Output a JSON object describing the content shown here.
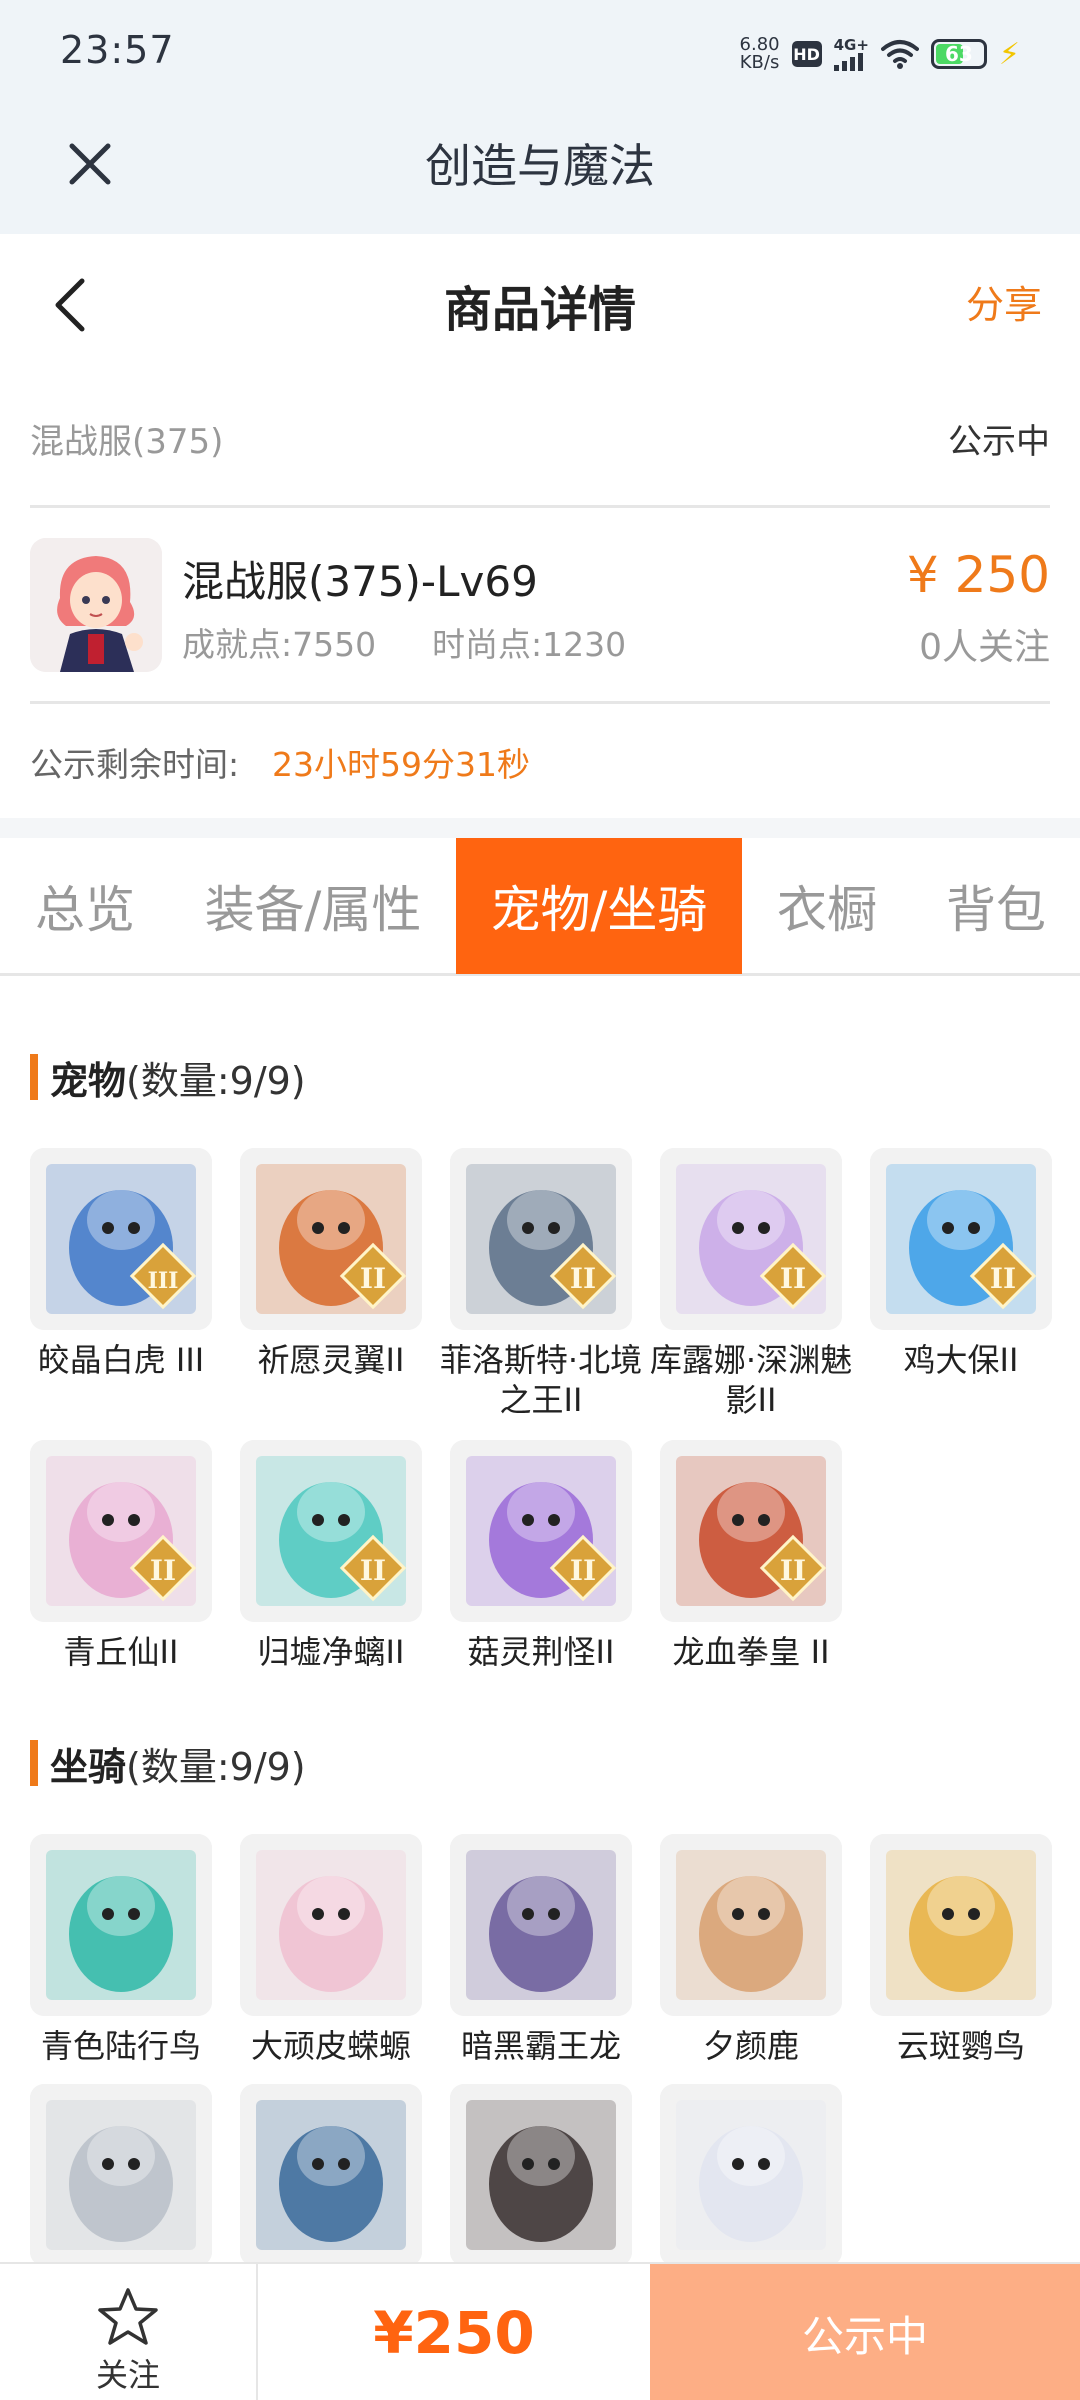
{
  "status_bar": {
    "time": "23:57",
    "net_speed_value": "6.80",
    "net_speed_unit": "KB/s",
    "hd": "HD",
    "signal": "4G+",
    "battery": "63"
  },
  "app": {
    "title": "创造与魔法"
  },
  "header": {
    "title": "商品详情",
    "share": "分享"
  },
  "item": {
    "server": "混战服(375)",
    "status": "公示中",
    "name": "混战服(375)-Lv69",
    "achievement": "成就点:7550",
    "fashion": "时尚点:1230",
    "price": "¥ 250",
    "followers": "0人关注",
    "timer_label": "公示剩余时间:",
    "timer_value": "23小时59分31秒"
  },
  "tabs": [
    "总览",
    "装备/属性",
    "宠物/坐骑",
    "衣橱",
    "背包"
  ],
  "pets": {
    "title": "宠物",
    "count": "(数量:9/9)",
    "items": [
      {
        "name": "皎晶白虎 III",
        "tier": "III",
        "color": "#3f78c8"
      },
      {
        "name": "祈愿灵翼II",
        "tier": "II",
        "color": "#d86a2a"
      },
      {
        "name": "菲洛斯特·北境之王II",
        "tier": "II",
        "color": "#5a7088"
      },
      {
        "name": "库露娜·深渊魅影II",
        "tier": "II",
        "color": "#c8a8e8"
      },
      {
        "name": "鸡大保II",
        "tier": "II",
        "color": "#3a9ee8"
      },
      {
        "name": "青丘仙II",
        "tier": "II",
        "color": "#e8a8d0"
      },
      {
        "name": "归墟净螭II",
        "tier": "II",
        "color": "#4cc8c0"
      },
      {
        "name": "菇灵荆怪II",
        "tier": "II",
        "color": "#9a6ad8"
      },
      {
        "name": "龙血拳皇 II",
        "tier": "II",
        "color": "#c84a2a"
      }
    ]
  },
  "mounts": {
    "title": "坐骑",
    "count": "(数量:9/9)",
    "items": [
      {
        "name": "青色陆行鸟",
        "color": "#2fb8a8"
      },
      {
        "name": "大顽皮蝾螈",
        "color": "#f0c0d0"
      },
      {
        "name": "暗黑霸王龙",
        "color": "#6a5a9a"
      },
      {
        "name": "夕颜鹿",
        "color": "#d8a070"
      },
      {
        "name": "云斑鹦鸟",
        "color": "#e8b040"
      },
      {
        "name": "",
        "color": "#b8c0c8"
      },
      {
        "name": "",
        "color": "#3a6a9a"
      },
      {
        "name": "",
        "color": "#3a3030"
      },
      {
        "name": "",
        "color": "#e0e4f0"
      }
    ]
  },
  "bottom": {
    "follow": "关注",
    "price": "¥250",
    "status": "公示中"
  }
}
